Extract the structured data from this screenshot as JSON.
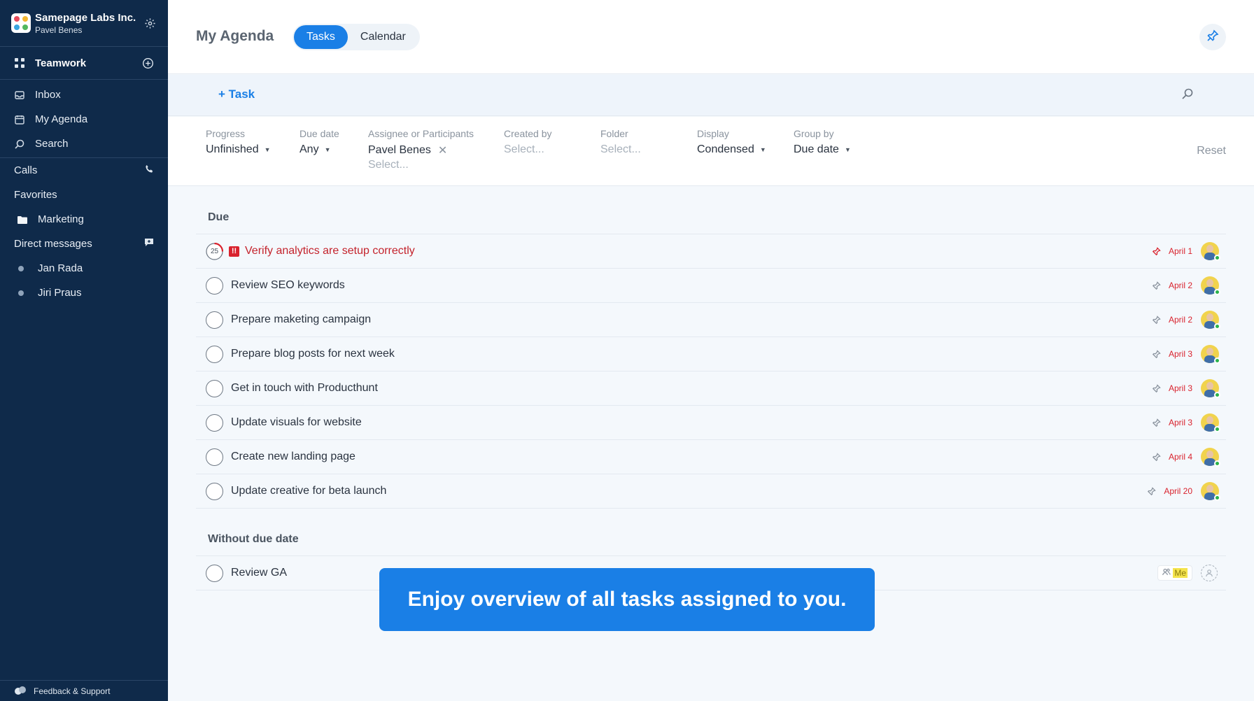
{
  "sidebar": {
    "org_name": "Samepage Labs Inc.",
    "user_name": "Pavel Benes",
    "workspace": "Teamwork",
    "nav": [
      {
        "label": "Inbox",
        "icon": "inbox-icon"
      },
      {
        "label": "My Agenda",
        "icon": "calendar-icon"
      },
      {
        "label": "Search",
        "icon": "search-icon"
      }
    ],
    "calls_label": "Calls",
    "favorites_label": "Favorites",
    "favorites": [
      {
        "label": "Marketing",
        "icon": "folder-icon"
      }
    ],
    "dm_label": "Direct messages",
    "dms": [
      {
        "label": "Jan Rada"
      },
      {
        "label": "Jiri Praus"
      }
    ],
    "feedback_label": "Feedback & Support"
  },
  "header": {
    "title": "My Agenda",
    "tabs": [
      {
        "label": "Tasks",
        "active": true
      },
      {
        "label": "Calendar",
        "active": false
      }
    ]
  },
  "toolbar": {
    "add_task_label": "+ Task"
  },
  "filters": {
    "progress": {
      "label": "Progress",
      "value": "Unfinished"
    },
    "due_date": {
      "label": "Due date",
      "value": "Any"
    },
    "assignee": {
      "label": "Assignee or Participants",
      "value": "Pavel Benes",
      "placeholder": "Select..."
    },
    "created_by": {
      "label": "Created by",
      "placeholder": "Select..."
    },
    "folder": {
      "label": "Folder",
      "placeholder": "Select..."
    },
    "display": {
      "label": "Display",
      "value": "Condensed"
    },
    "group_by": {
      "label": "Group by",
      "value": "Due date"
    },
    "reset_label": "Reset"
  },
  "groups": {
    "due": {
      "title": "Due",
      "tasks": [
        {
          "title": "Verify analytics are setup correctly",
          "date": "April 1",
          "progress": "25",
          "priority": "!!"
        },
        {
          "title": "Review SEO keywords",
          "date": "April 2"
        },
        {
          "title": "Prepare maketing campaign",
          "date": "April 2"
        },
        {
          "title": "Prepare blog posts for next week",
          "date": "April 3"
        },
        {
          "title": "Get in touch with Producthunt",
          "date": "April 3"
        },
        {
          "title": "Update visuals for website",
          "date": "April 3"
        },
        {
          "title": "Create new landing page",
          "date": "April 4"
        },
        {
          "title": "Update creative for beta launch",
          "date": "April 20"
        }
      ]
    },
    "no_due": {
      "title": "Without due date",
      "tasks": [
        {
          "title": "Review GA",
          "chip": "Me"
        }
      ]
    }
  },
  "banner": {
    "text": "Enjoy overview of all tasks assigned to you."
  },
  "colors": {
    "sidebar_bg": "#0f2a4a",
    "accent": "#1a7fe6",
    "overdue": "#c4232c",
    "date_red": "#d9232e"
  }
}
